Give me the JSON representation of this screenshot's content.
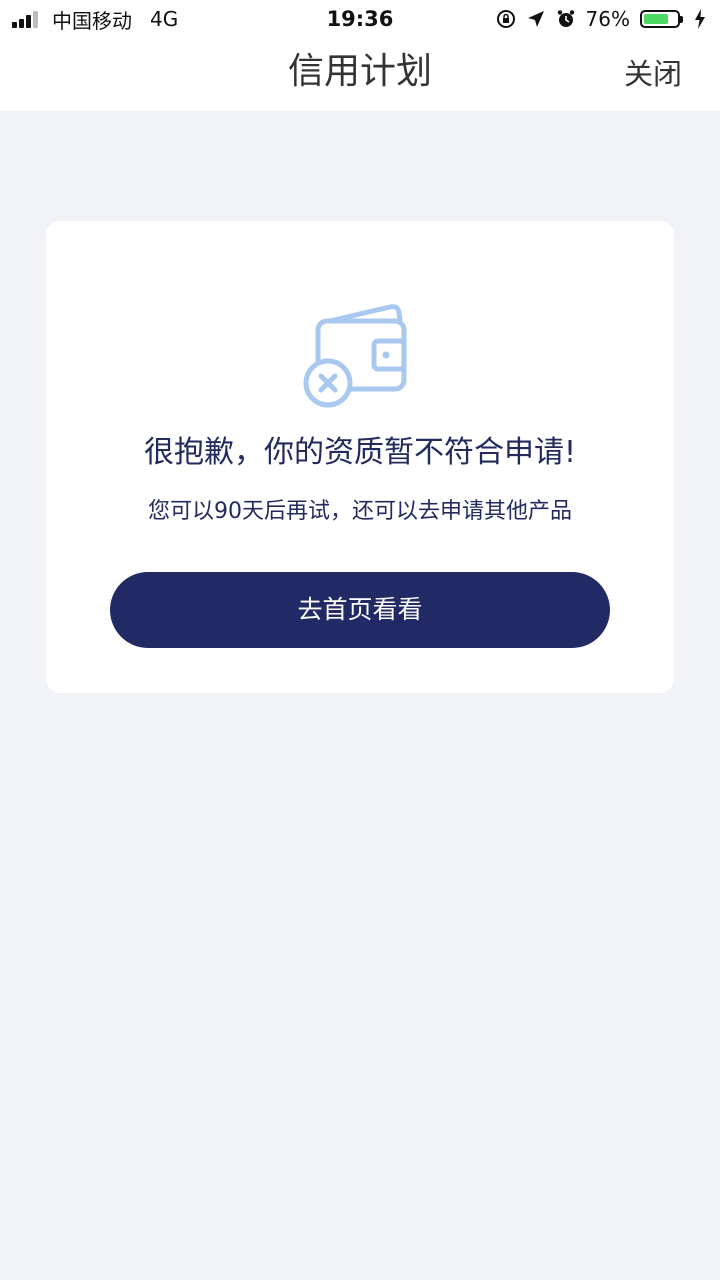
{
  "status_bar": {
    "carrier": "中国移动",
    "network": "4G",
    "time": "19:36",
    "battery_percent": "76%",
    "battery_level": 0.76,
    "battery_color": "#4cd964",
    "icons": [
      "signal-icon",
      "rotation-lock-icon",
      "location-arrow-icon",
      "alarm-clock-icon",
      "battery-icon",
      "charging-bolt-icon"
    ]
  },
  "nav": {
    "title": "信用计划",
    "close_label": "关闭"
  },
  "result": {
    "icon": "wallet-rejected-icon",
    "title": "很抱歉，你的资质暂不符合申请!",
    "subtitle": "您可以90天后再试，还可以去申请其他产品",
    "button_label": "去首页看看"
  },
  "colors": {
    "page_bg": "#f1f3f7",
    "primary": "#222a66",
    "text_dark": "#222a5e",
    "icon_light": "#a9c8f0"
  }
}
